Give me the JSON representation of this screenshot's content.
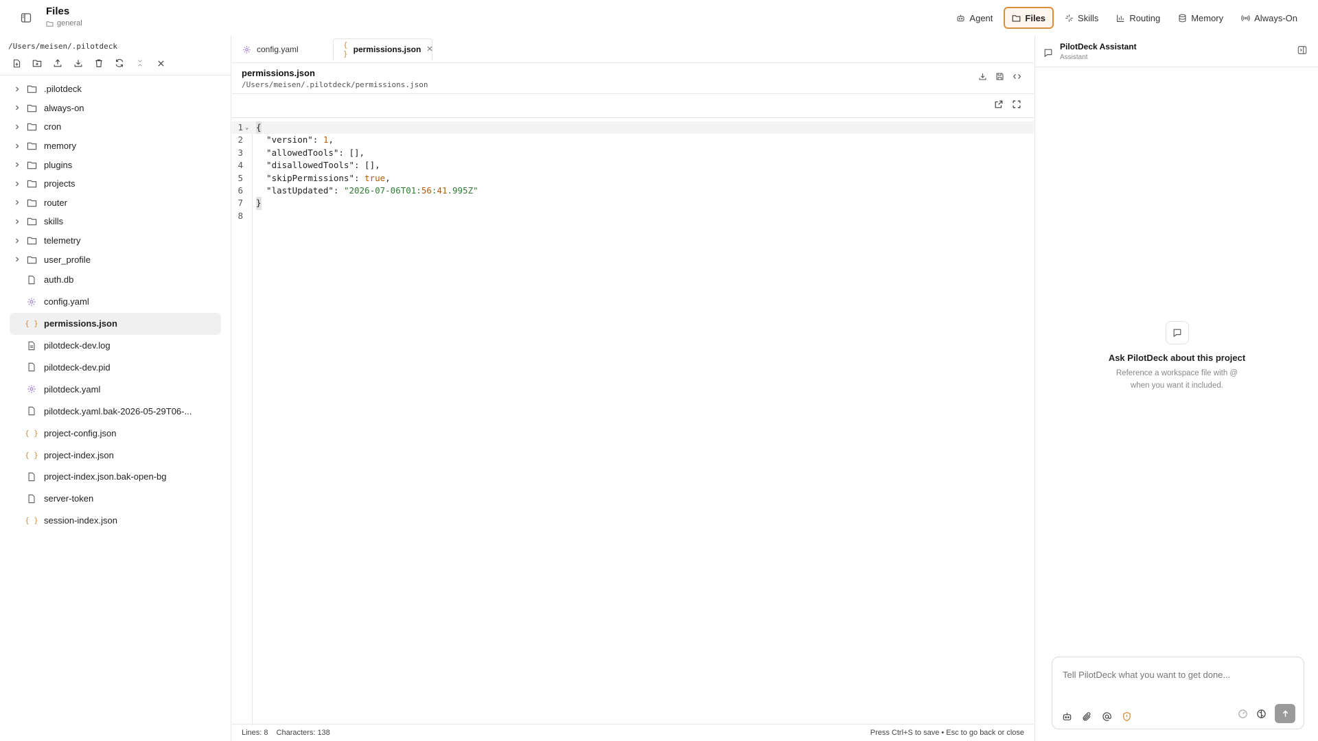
{
  "app": {
    "title": "Files",
    "subtitle": "general"
  },
  "nav": {
    "items": [
      {
        "label": "Agent",
        "icon": "robot-icon",
        "active": false
      },
      {
        "label": "Files",
        "icon": "folder-icon",
        "active": true
      },
      {
        "label": "Skills",
        "icon": "sparkle-icon",
        "active": false
      },
      {
        "label": "Routing",
        "icon": "bar-chart-icon",
        "active": false
      },
      {
        "label": "Memory",
        "icon": "database-icon",
        "active": false
      },
      {
        "label": "Always-On",
        "icon": "broadcast-icon",
        "active": false
      }
    ],
    "accent": "#d98e3c"
  },
  "explorer": {
    "root_path": "/Users/meisen/.pilotdeck",
    "toolbar": [
      "new-file-icon",
      "new-folder-icon",
      "upload-icon",
      "download-icon",
      "trash-icon",
      "refresh-icon",
      "collapse-icon",
      "close-icon"
    ],
    "folders": [
      ".pilotdeck",
      "always-on",
      "cron",
      "memory",
      "plugins",
      "projects",
      "router",
      "skills",
      "telemetry",
      "user_profile"
    ],
    "files": [
      {
        "name": "auth.db",
        "icon": "file-icon"
      },
      {
        "name": "config.yaml",
        "icon": "gear-icon"
      },
      {
        "name": "permissions.json",
        "icon": "braces-icon",
        "selected": true
      },
      {
        "name": "pilotdeck-dev.log",
        "icon": "log-icon"
      },
      {
        "name": "pilotdeck-dev.pid",
        "icon": "file-icon"
      },
      {
        "name": "pilotdeck.yaml",
        "icon": "gear-icon"
      },
      {
        "name": "pilotdeck.yaml.bak-2026-05-29T06-...",
        "icon": "file-icon"
      },
      {
        "name": "project-config.json",
        "icon": "braces-icon"
      },
      {
        "name": "project-index.json",
        "icon": "braces-icon"
      },
      {
        "name": "project-index.json.bak-open-bg",
        "icon": "file-icon"
      },
      {
        "name": "server-token",
        "icon": "file-icon"
      },
      {
        "name": "session-index.json",
        "icon": "braces-icon"
      }
    ]
  },
  "editor": {
    "tabs": [
      {
        "label": "config.yaml",
        "icon": "gear-icon",
        "active": false
      },
      {
        "label": "permissions.json",
        "icon": "braces-icon",
        "active": true
      }
    ],
    "file_name": "permissions.json",
    "file_path": "/Users/meisen/.pilotdeck/permissions.json",
    "lines": [
      {
        "n": "1",
        "text": "{"
      },
      {
        "n": "2",
        "text": "  \"version\": 1,"
      },
      {
        "n": "3",
        "text": "  \"allowedTools\": [],"
      },
      {
        "n": "4",
        "text": "  \"disallowedTools\": [],"
      },
      {
        "n": "5",
        "text": "  \"skipPermissions\": true,"
      },
      {
        "n": "6",
        "text": "  \"lastUpdated\": \"2026-07-06T01:56:41.995Z\""
      },
      {
        "n": "7",
        "text": "}"
      },
      {
        "n": "8",
        "text": ""
      }
    ],
    "status": {
      "lines": "Lines: 8",
      "characters": "Characters: 138",
      "hint": "Press Ctrl+S to save • Esc to go back or close"
    }
  },
  "assistant": {
    "title": "PilotDeck Assistant",
    "subtitle": "Assistant",
    "empty_title": "Ask PilotDeck about this project",
    "empty_desc": "Reference a workspace file with @ when you want it included.",
    "input_placeholder": "Tell PilotDeck what you want to get done..."
  }
}
